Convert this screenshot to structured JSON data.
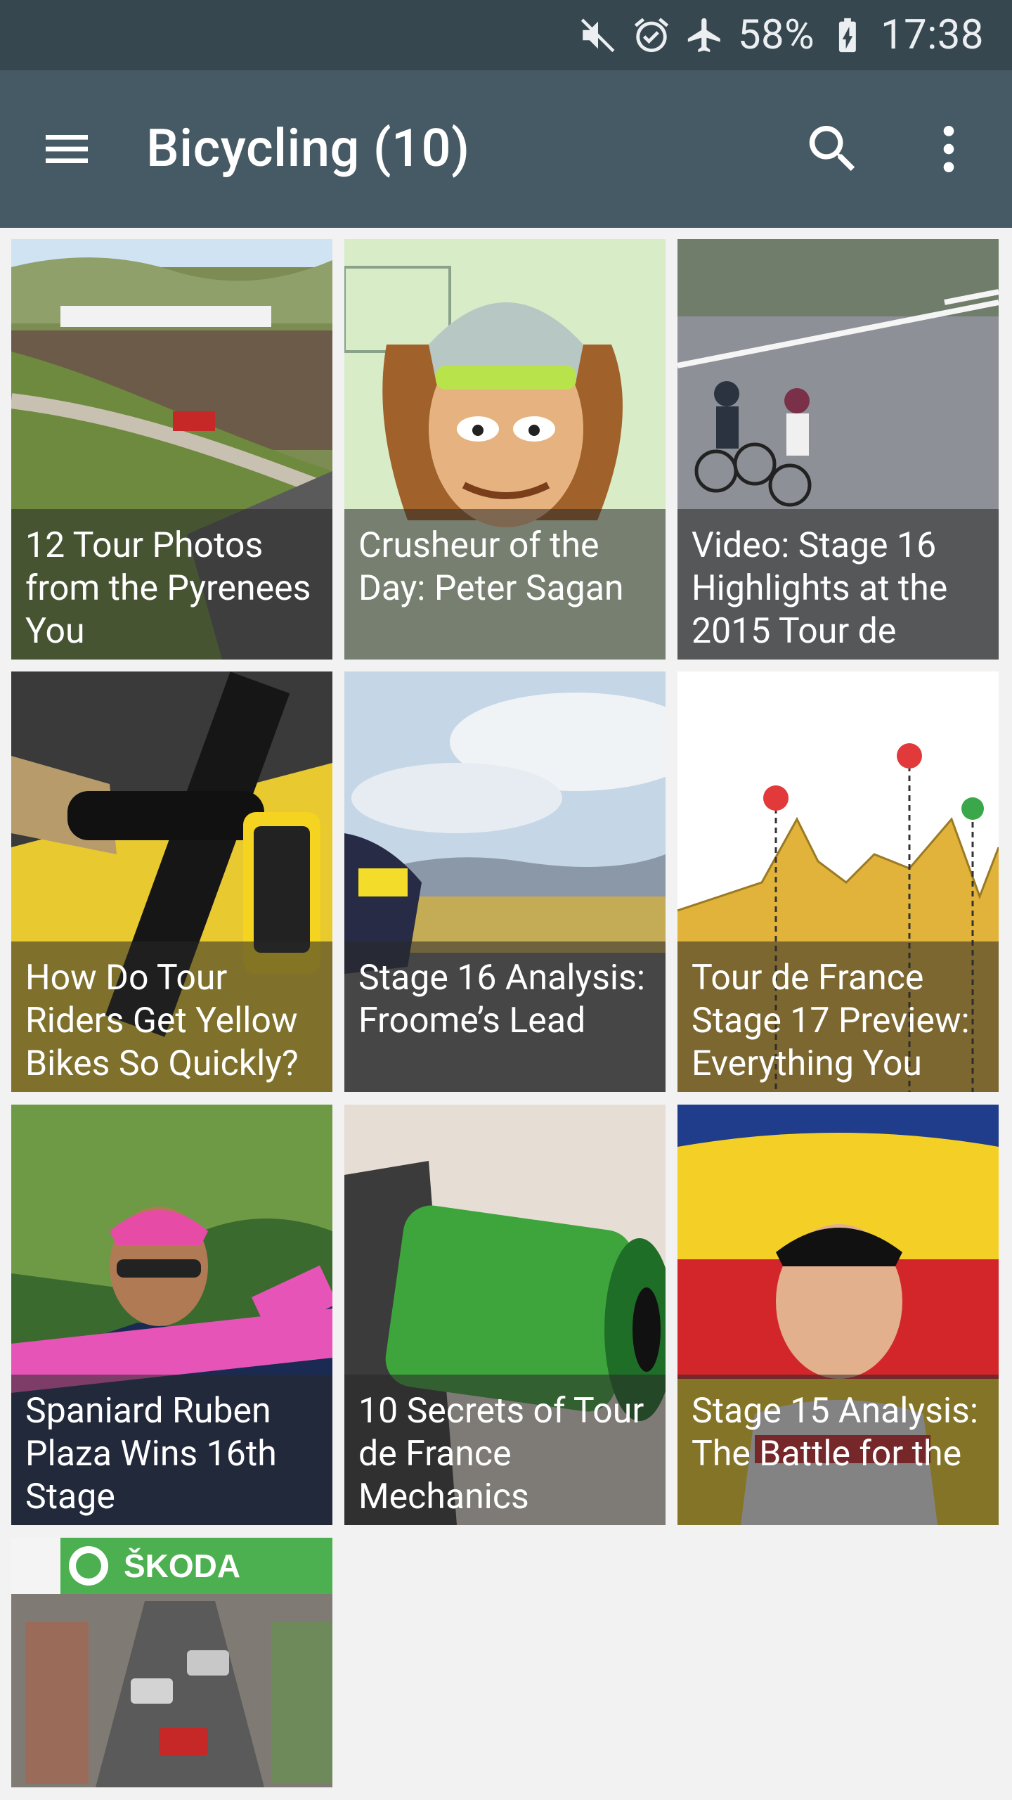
{
  "status_bar": {
    "battery": "58%",
    "time": "17:38",
    "icons": [
      "mute-icon",
      "alarm-icon",
      "airplane-icon",
      "battery-charging-icon"
    ]
  },
  "app_bar": {
    "title": "Bicycling (10)",
    "icons": [
      "menu-icon",
      "search-icon",
      "more-vert-icon"
    ]
  },
  "tiles": [
    {
      "caption": "12 Tour Photos from the Pyrenees You",
      "image": "mountain-crowd"
    },
    {
      "caption": "Crusheur of the Day: Peter Sagan",
      "image": "cartoon-portrait"
    },
    {
      "caption": "Video: Stage 16 Highlights at the 2015 Tour de",
      "image": "riders-road"
    },
    {
      "caption": "How Do Tour Riders Get Yellow Bikes So Quickly?",
      "image": "handlebar-closeup"
    },
    {
      "caption": "Stage 16 Analysis: Froome’s Lead",
      "image": "rider-landscape"
    },
    {
      "caption": "Tour de France Stage 17 Preview: Everything You",
      "image": "stage-profile"
    },
    {
      "caption": "Spaniard Ruben Plaza Wins 16th Stage",
      "image": "winning-rider"
    },
    {
      "caption": "10 Secrets of Tour de France Mechanics",
      "image": "green-part"
    },
    {
      "caption": "Stage 15 Analysis: The Battle for the",
      "image": "podium-rider"
    },
    {
      "caption": "",
      "image": "finish-line-skoda"
    }
  ],
  "colors": {
    "status_bar": "#37474f",
    "app_bar": "#455a64",
    "background": "#f2f2f2"
  }
}
